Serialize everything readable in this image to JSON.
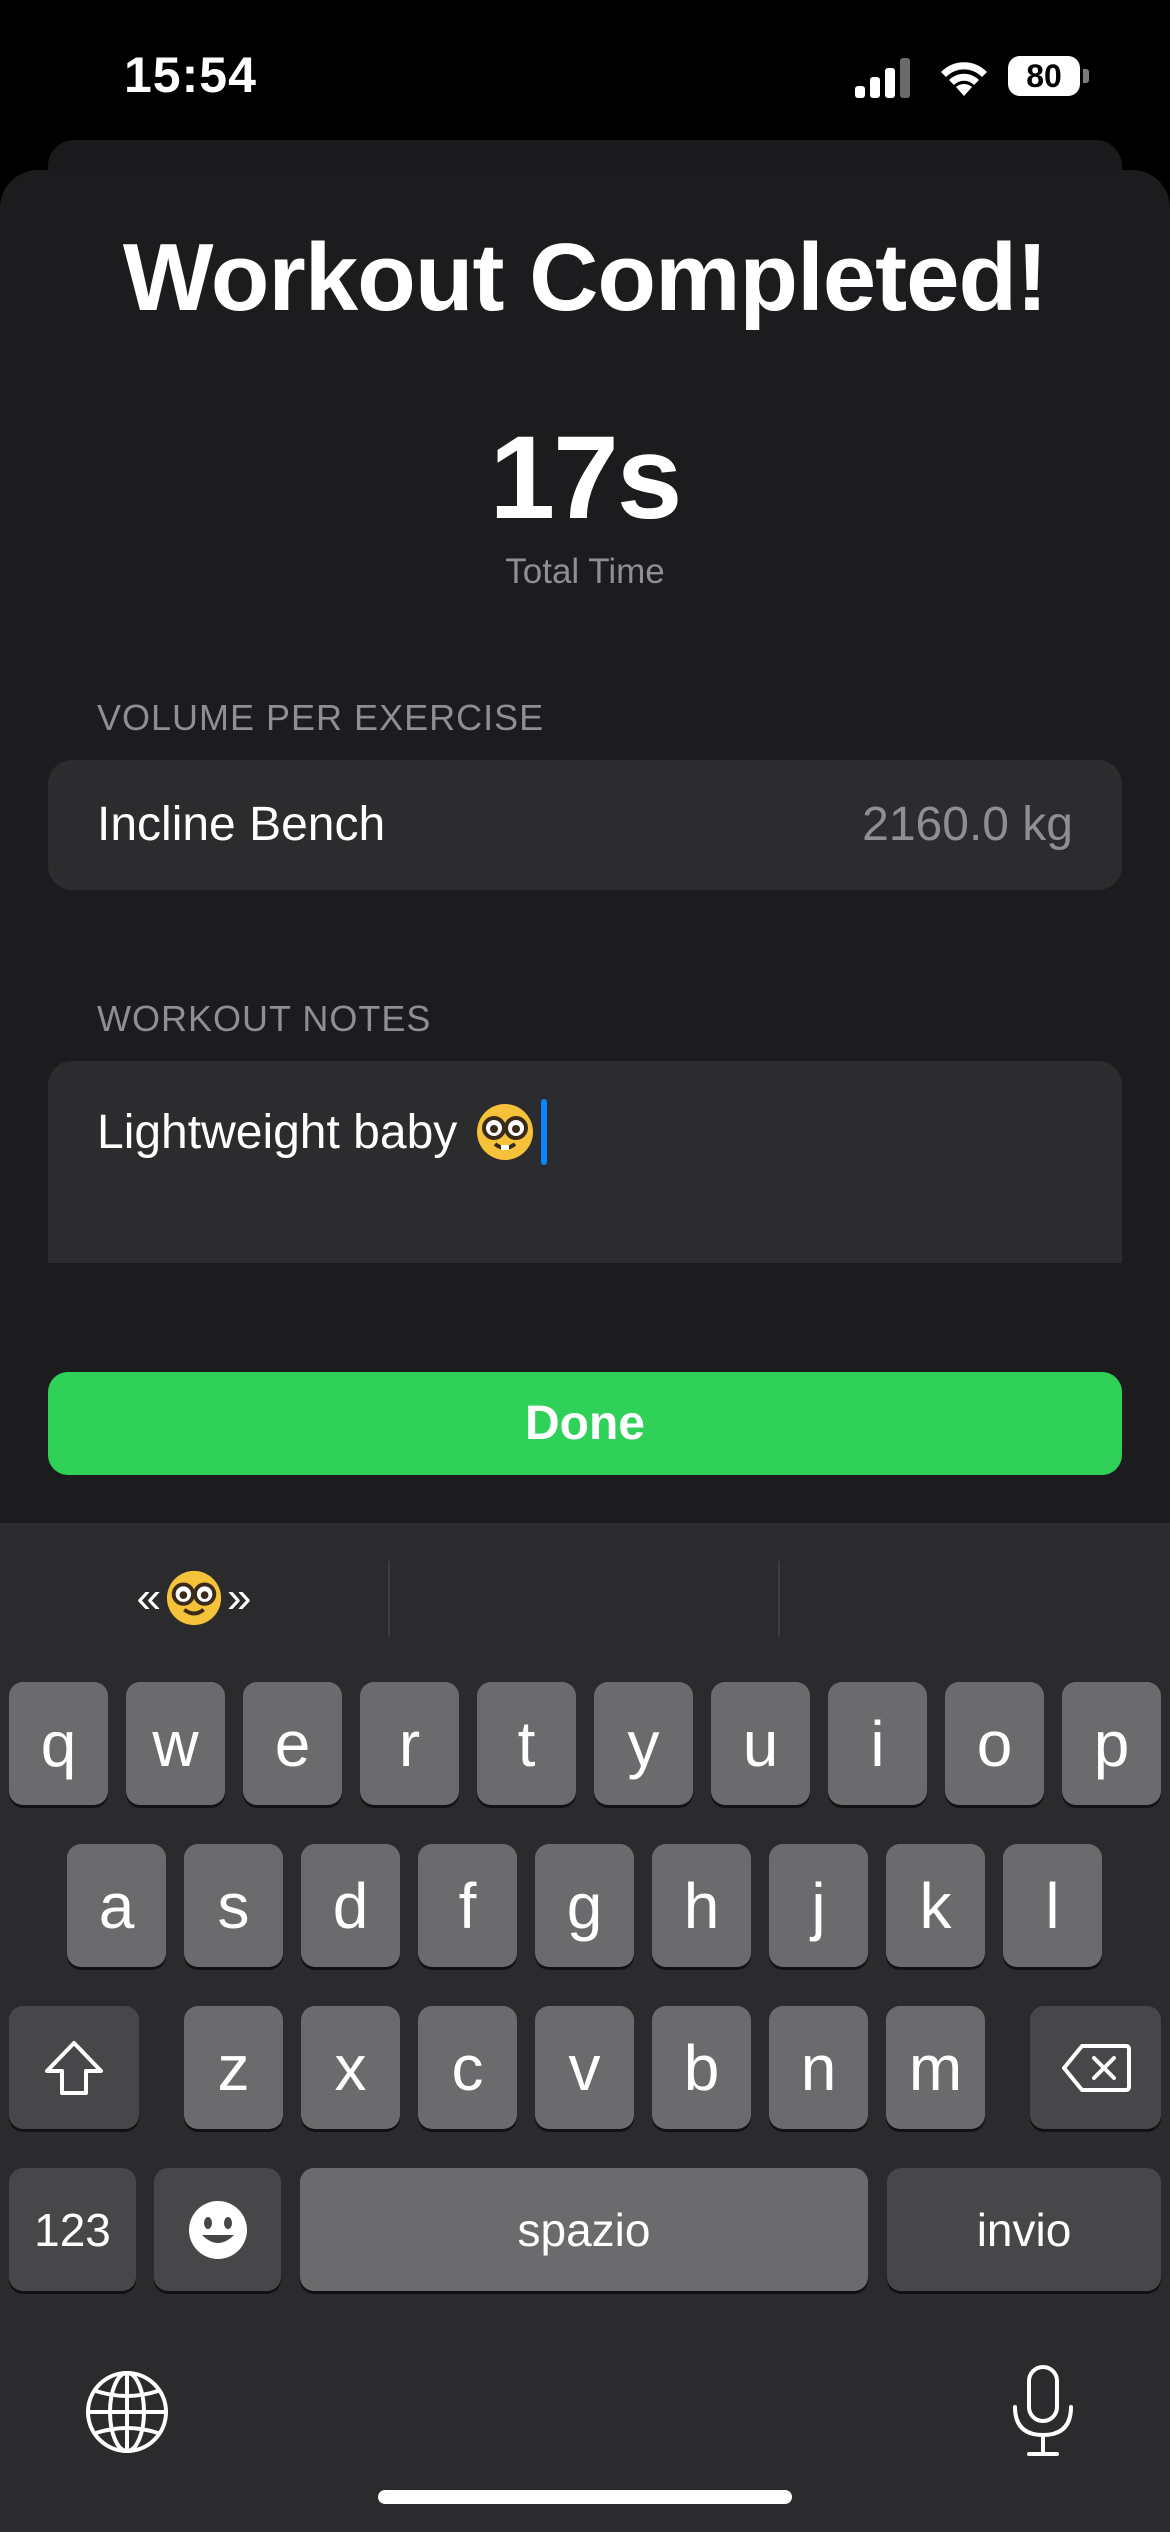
{
  "status_bar": {
    "time": "15:54",
    "battery": "80"
  },
  "sheet": {
    "title": "Workout Completed!",
    "total_time": {
      "value": "17s",
      "label": "Total Time"
    },
    "volume_section": {
      "header": "VOLUME PER EXERCISE",
      "rows": [
        {
          "exercise": "Incline Bench",
          "volume": "2160.0 kg"
        }
      ]
    },
    "notes_section": {
      "header": "WORKOUT NOTES",
      "text": "Lightweight baby"
    },
    "done_label": "Done"
  },
  "keyboard": {
    "suggestion_left": "«",
    "suggestion_right": "»",
    "row1": [
      "q",
      "w",
      "e",
      "r",
      "t",
      "y",
      "u",
      "i",
      "o",
      "p"
    ],
    "row2": [
      "a",
      "s",
      "d",
      "f",
      "g",
      "h",
      "j",
      "k",
      "l"
    ],
    "row3": [
      "z",
      "x",
      "c",
      "v",
      "b",
      "n",
      "m"
    ],
    "numbers_label": "123",
    "space_label": "spazio",
    "return_label": "invio"
  },
  "icons": [
    "signal-icon",
    "wifi-icon",
    "battery-icon",
    "nerd-face-emoji",
    "shift-icon",
    "backspace-icon",
    "emoji-icon",
    "globe-icon",
    "microphone-icon"
  ],
  "colors": {
    "accent_green": "#30d158",
    "caret_blue": "#0a84ff",
    "sheet_bg": "#1c1c1e",
    "card_bg": "#2c2c2e",
    "secondary_text": "#8e8e93"
  }
}
